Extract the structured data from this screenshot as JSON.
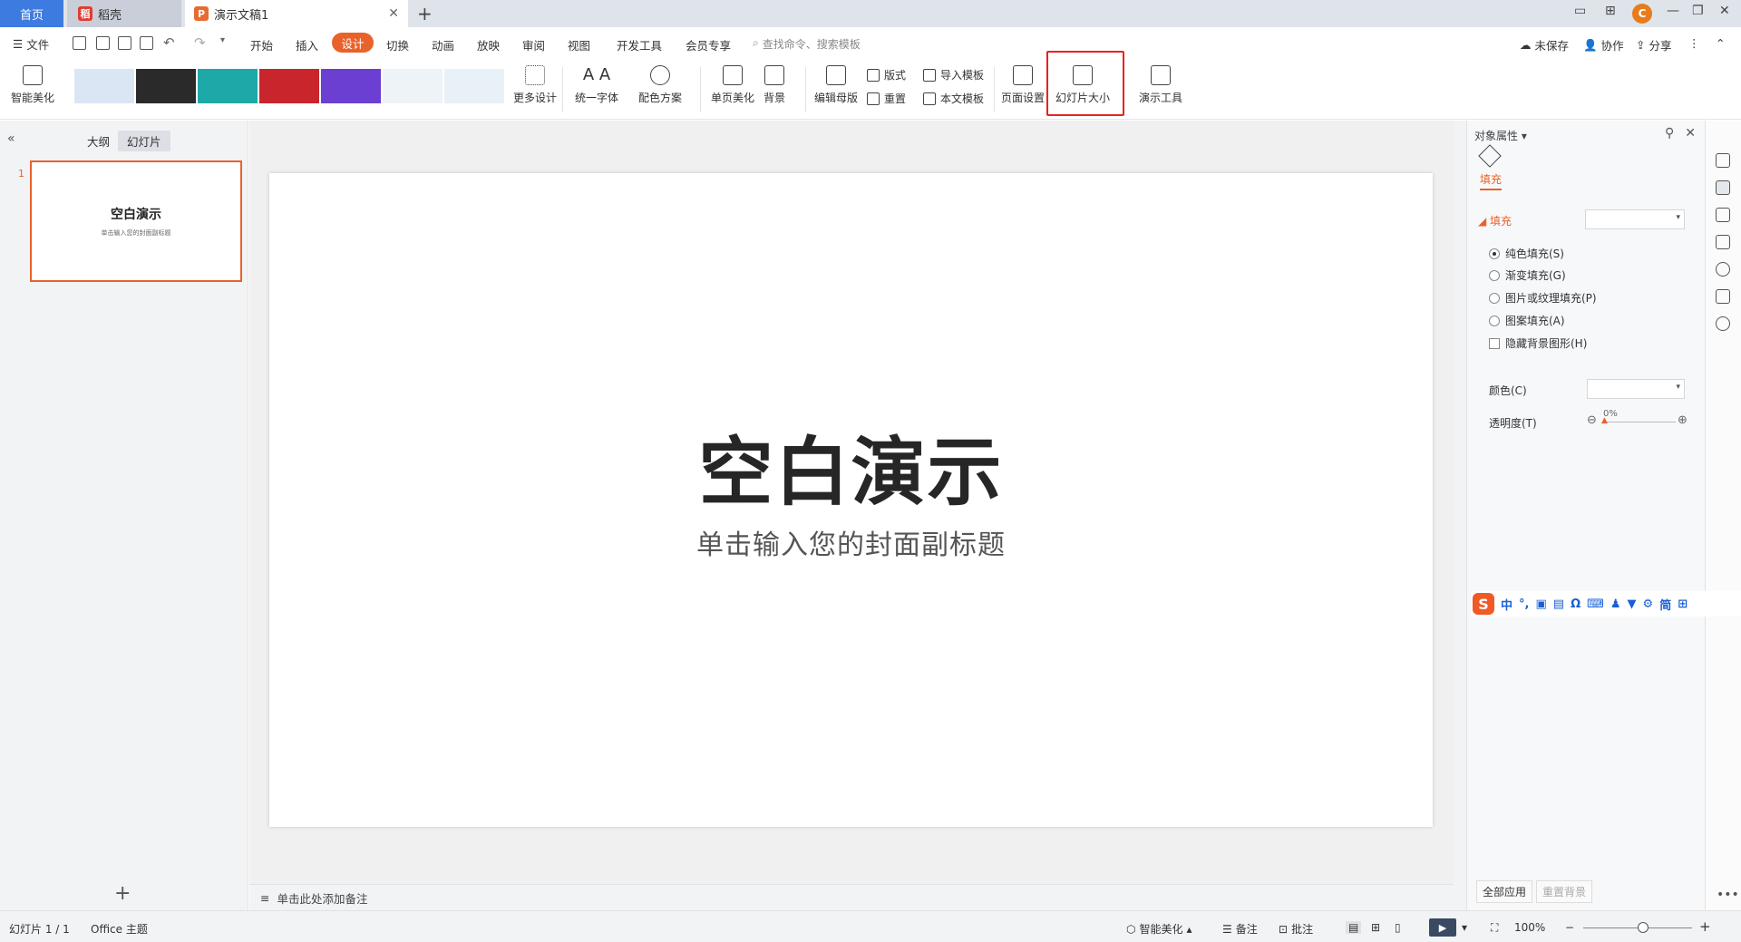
{
  "tabs": {
    "home": "首页",
    "daoke": "稻壳",
    "doc": "演示文稿1",
    "new_tab": "+"
  },
  "menu": {
    "file": "文件",
    "items": [
      "开始",
      "插入",
      "设计",
      "切换",
      "动画",
      "放映",
      "审阅",
      "视图",
      "开发工具",
      "会员专享"
    ],
    "active": "设计",
    "search_placeholder": "查找命令、搜索模板",
    "unsaved": "未保存",
    "collab": "协作",
    "share": "分享"
  },
  "ribbon": {
    "smart_beautify": "智能美化",
    "more_design": "更多设计",
    "unify_font": "统一字体",
    "color_scheme": "配色方案",
    "page_beautify": "单页美化",
    "background": "背景",
    "edit_master": "编辑母版",
    "layout": "版式",
    "reset": "重置",
    "import_template": "导入模板",
    "this_template": "本文模板",
    "page_setup": "页面设置",
    "slide_size": "幻灯片大小",
    "presentation_tools": "演示工具",
    "template_colors": [
      "#dbe6f5",
      "#2a2a2a",
      "#1fa8a8",
      "#c8252c",
      "#6a3fd1",
      "#eef3f8",
      "#e9f1f8"
    ]
  },
  "left_pane": {
    "tab_outline": "大纲",
    "tab_slides": "幻灯片",
    "slide_number": "1",
    "thumb_title": "空白演示",
    "thumb_subtitle": "单击输入您的封面副标题"
  },
  "slide": {
    "title": "空白演示",
    "subtitle": "单击输入您的封面副标题"
  },
  "notes_placeholder": "单击此处添加备注",
  "right_pane": {
    "title": "对象属性",
    "tab_fill": "填充",
    "section_fill": "填充",
    "options": [
      "纯色填充(S)",
      "渐变填充(G)",
      "图片或纹理填充(P)",
      "图案填充(A)"
    ],
    "selected_option": "纯色填充(S)",
    "hide_bg_graphics": "隐藏背景图形(H)",
    "color_label": "颜色(C)",
    "transparency_label": "透明度(T)",
    "transparency_value": "0%",
    "apply_all": "全部应用",
    "reset_bg": "重置背景"
  },
  "ime_bar": {
    "logo": "S",
    "items": [
      "中",
      "°,",
      "简"
    ]
  },
  "status_bar": {
    "slide_count": "幻灯片 1 / 1",
    "theme": "Office 主题",
    "smart_beautify": "智能美化",
    "notes": "备注",
    "comments": "批注",
    "zoom": "100%"
  },
  "colors": {
    "accent": "#e8622a",
    "highlight_annotation": "#e8221c",
    "home_tab": "#3d7be0"
  }
}
